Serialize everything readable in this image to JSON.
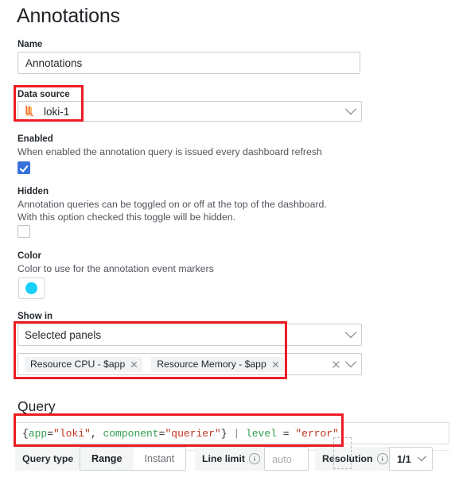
{
  "page": {
    "title": "Annotations"
  },
  "name_field": {
    "label": "Name",
    "value": "Annotations"
  },
  "data_source": {
    "label": "Data source",
    "value": "loki-1",
    "icon": "loki-logo-icon",
    "chevron": "chevron-down-icon"
  },
  "enabled": {
    "label": "Enabled",
    "description": "When enabled the annotation query is issued every dashboard refresh",
    "checked": true
  },
  "hidden": {
    "label": "Hidden",
    "description": "Annotation queries can be toggled on or off at the top of the dashboard. With this option checked this toggle will be hidden.",
    "checked": false
  },
  "color": {
    "label": "Color",
    "description": "Color to use for the annotation event markers",
    "value": "#18d0fb"
  },
  "show_in": {
    "label": "Show in",
    "value": "Selected panels",
    "panels": [
      {
        "label": "Resource CPU - $app",
        "remove_icon": "close-icon"
      },
      {
        "label": "Resource Memory - $app",
        "remove_icon": "close-icon"
      }
    ],
    "clear_icon": "clear-icon",
    "chevron": "chevron-down-icon"
  },
  "query": {
    "section_title": "Query",
    "tokens": [
      {
        "text": "{",
        "type": "brace"
      },
      {
        "text": "app",
        "type": "label"
      },
      {
        "text": "=",
        "type": "op"
      },
      {
        "text": "\"loki\"",
        "type": "string"
      },
      {
        "text": ", ",
        "type": "brace"
      },
      {
        "text": "component",
        "type": "label"
      },
      {
        "text": "=",
        "type": "op"
      },
      {
        "text": "\"querier\"",
        "type": "string"
      },
      {
        "text": "}",
        "type": "brace"
      },
      {
        "text": " | ",
        "type": "pipe"
      },
      {
        "text": "level",
        "type": "label"
      },
      {
        "text": " = ",
        "type": "op"
      },
      {
        "text": "\"error\"",
        "type": "string"
      }
    ],
    "text": "{app=\"loki\", component=\"querier\"} | level = \"error\""
  },
  "toolbar": {
    "query_type_label": "Query type",
    "query_type_options": [
      "Range",
      "Instant"
    ],
    "query_type_selected": "Range",
    "line_limit_label": "Line limit",
    "line_limit_placeholder": "auto",
    "line_limit_value": "",
    "resolution_label": "Resolution",
    "resolution_value": "1/1",
    "info_icon": "info-icon",
    "chevron": "chevron-down-icon"
  },
  "annotations_overlay": {
    "boxes": [
      {
        "name": "highlight-data-source"
      },
      {
        "name": "highlight-show-in"
      },
      {
        "name": "highlight-query"
      }
    ],
    "color": "#ed1c24"
  }
}
